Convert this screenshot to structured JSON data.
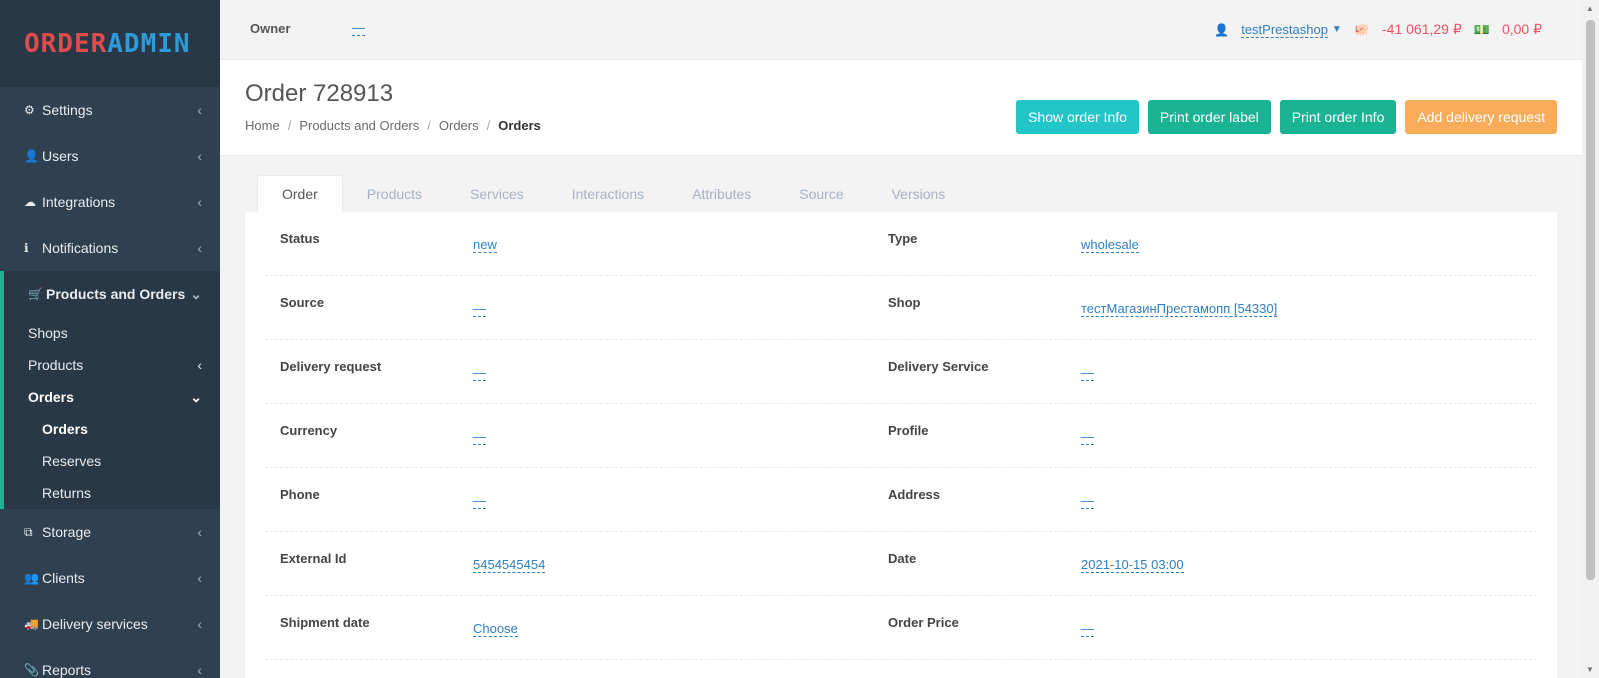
{
  "logo": {
    "part1": "ORDER",
    "part2": "ADMIN"
  },
  "sidebar": {
    "items": [
      {
        "label": "Settings",
        "icon": "gear-icon",
        "glyph": "⚙"
      },
      {
        "label": "Users",
        "icon": "user-icon",
        "glyph": "👤"
      },
      {
        "label": "Integrations",
        "icon": "cloud-download-icon",
        "glyph": "☁"
      },
      {
        "label": "Notifications",
        "icon": "info-circle-icon",
        "glyph": "ℹ"
      },
      {
        "label": "Products and Orders",
        "icon": "shopping-cart-icon",
        "glyph": "🛒"
      }
    ],
    "sub": {
      "shops": "Shops",
      "products": "Products",
      "orders": "Orders",
      "orders_sub": "Orders",
      "reserves": "Reserves",
      "returns": "Returns"
    },
    "items_bottom": [
      {
        "label": "Storage",
        "icon": "cubes-icon",
        "glyph": "⧉"
      },
      {
        "label": "Clients",
        "icon": "users-icon",
        "glyph": "👥"
      },
      {
        "label": "Delivery services",
        "icon": "truck-icon",
        "glyph": "🚚"
      },
      {
        "label": "Reports",
        "icon": "paperclip-icon",
        "glyph": "📎"
      }
    ]
  },
  "topbar": {
    "owner_label": "Owner",
    "owner_value": "—",
    "user_name": "testPrestashop",
    "balance1": "-41 061,29 ₽",
    "balance2": "0,00 ₽"
  },
  "header": {
    "title": "Order 728913",
    "breadcrumb": [
      "Home",
      "Products and Orders",
      "Orders",
      "Orders"
    ],
    "buttons": {
      "show_info": "Show order Info",
      "print_label": "Print order label",
      "print_info": "Print order Info",
      "add_delivery": "Add delivery request"
    }
  },
  "tabs": [
    "Order",
    "Products",
    "Services",
    "Interactions",
    "Attributes",
    "Source",
    "Versions"
  ],
  "fields": {
    "status_label": "Status",
    "status_value": "new",
    "type_label": "Type",
    "type_value": "wholesale",
    "source_label": "Source",
    "source_value": "—",
    "shop_label": "Shop",
    "shop_value": "тестМагазинПрестамопп [54330]",
    "delivery_request_label": "Delivery request",
    "delivery_request_value": "—",
    "delivery_service_label": "Delivery Service",
    "delivery_service_value": "—",
    "currency_label": "Currency",
    "currency_value": "—",
    "profile_label": "Profile",
    "profile_value": "—",
    "phone_label": "Phone",
    "phone_value": "—",
    "address_label": "Address",
    "address_value": "—",
    "external_id_label": "External Id",
    "external_id_value": "5454545454",
    "date_label": "Date",
    "date_value": "2021-10-15 03:00",
    "shipment_date_label": "Shipment date",
    "shipment_date_value": "Choose",
    "order_price_label": "Order Price",
    "order_price_value": "—"
  }
}
